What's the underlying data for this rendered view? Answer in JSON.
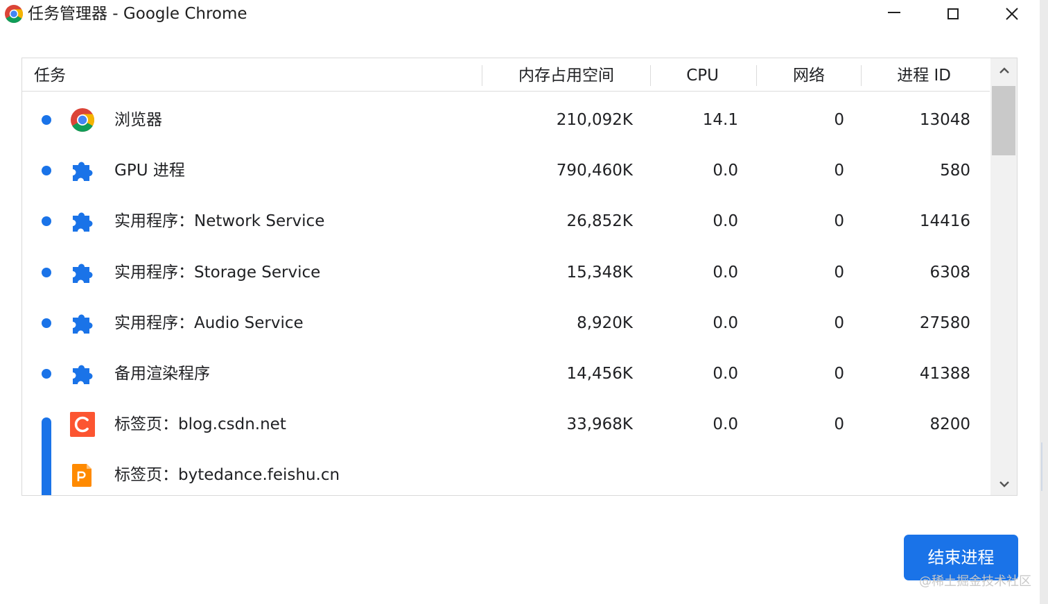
{
  "window": {
    "title": "任务管理器 - Google Chrome",
    "controls": {
      "minimize": "minimize",
      "maximize": "maximize",
      "close": "close"
    }
  },
  "table": {
    "headers": {
      "task": "任务",
      "memory": "内存占用空间",
      "cpu": "CPU",
      "network": "网络",
      "pid": "进程 ID"
    },
    "rows": [
      {
        "icon": "chrome-icon",
        "name": "浏览器",
        "memory": "210,092K",
        "cpu": "14.1",
        "network": "0",
        "pid": "13048"
      },
      {
        "icon": "puzzle-extension-icon",
        "name": "GPU 进程",
        "memory": "790,460K",
        "cpu": "0.0",
        "network": "0",
        "pid": "580"
      },
      {
        "icon": "puzzle-extension-icon",
        "name": "实用程序：Network Service",
        "memory": "26,852K",
        "cpu": "0.0",
        "network": "0",
        "pid": "14416"
      },
      {
        "icon": "puzzle-extension-icon",
        "name": "实用程序：Storage Service",
        "memory": "15,348K",
        "cpu": "0.0",
        "network": "0",
        "pid": "6308"
      },
      {
        "icon": "puzzle-extension-icon",
        "name": "实用程序：Audio Service",
        "memory": "8,920K",
        "cpu": "0.0",
        "network": "0",
        "pid": "27580"
      },
      {
        "icon": "puzzle-extension-icon",
        "name": "备用渲染程序",
        "memory": "14,456K",
        "cpu": "0.0",
        "network": "0",
        "pid": "41388"
      },
      {
        "icon": "csdn-favicon",
        "name": "标签页：blog.csdn.net",
        "memory": "33,968K",
        "cpu": "0.0",
        "network": "0",
        "pid": "8200"
      },
      {
        "icon": "feishu-favicon",
        "name": "标签页：bytedance.feishu.cn",
        "memory": "",
        "cpu": "",
        "network": "",
        "pid": ""
      }
    ]
  },
  "actions": {
    "end_process": "结束进程"
  },
  "watermark": "@稀土掘金技术社区",
  "colors": {
    "accent": "#1a73e8",
    "csdn": "#fc5531",
    "feishu": "#ff8a00"
  }
}
